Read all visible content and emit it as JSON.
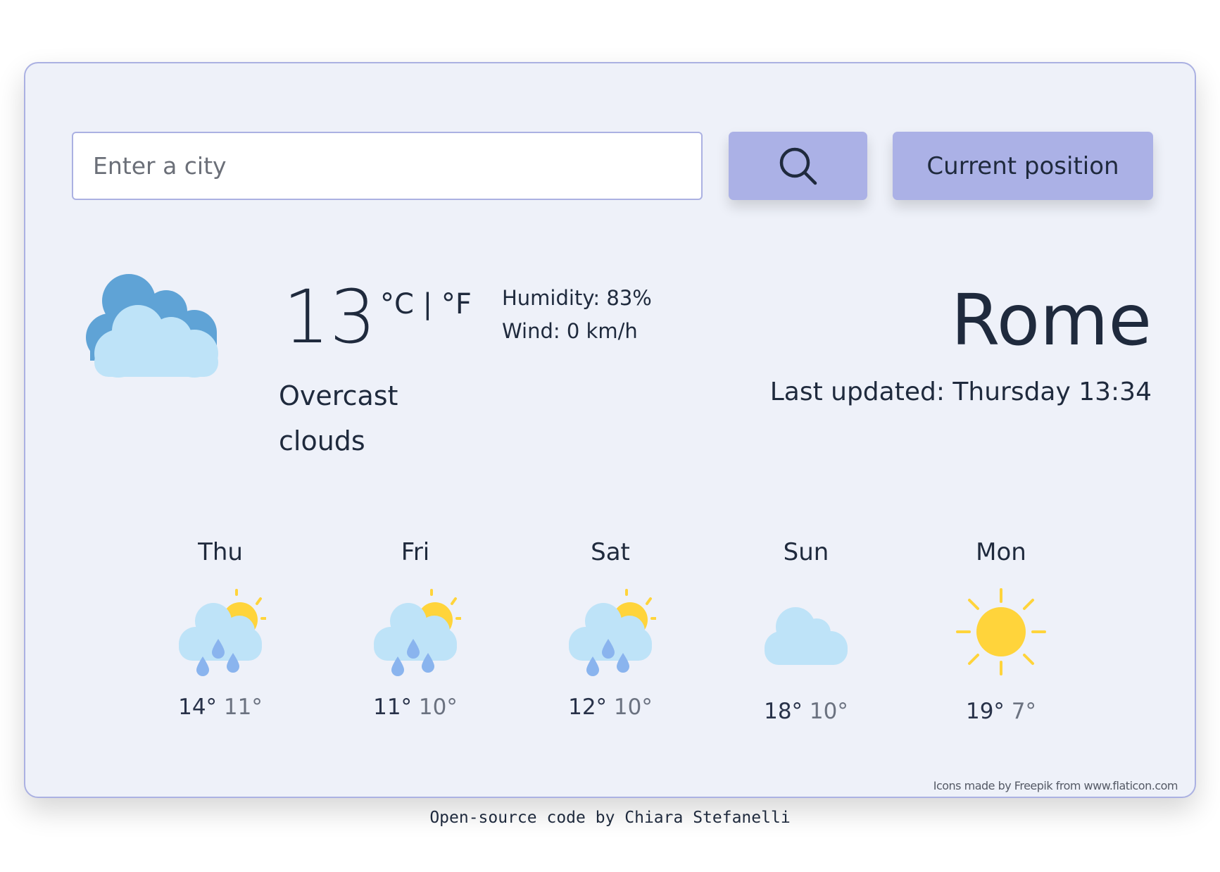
{
  "search": {
    "placeholder": "Enter a city",
    "value": "",
    "search_button_icon": "search-icon",
    "current_position_label": "Current position"
  },
  "current": {
    "icon": "overcast-clouds-icon",
    "temperature": "13",
    "unit_celsius": "°C",
    "unit_separator": "|",
    "unit_fahrenheit": "°F",
    "humidity": "Humidity: 83%",
    "wind": "Wind: 0 km/h",
    "description": "Overcast clouds",
    "city": "Rome",
    "last_updated": "Last updated: Thursday 13:34"
  },
  "forecast": [
    {
      "day": "Thu",
      "icon": "rain-sun-icon",
      "max": "14°",
      "min": "11°"
    },
    {
      "day": "Fri",
      "icon": "rain-sun-icon",
      "max": "11°",
      "min": "10°"
    },
    {
      "day": "Sat",
      "icon": "rain-sun-icon",
      "max": "12°",
      "min": "10°"
    },
    {
      "day": "Sun",
      "icon": "cloud-icon",
      "max": "18°",
      "min": "10°"
    },
    {
      "day": "Mon",
      "icon": "sun-icon",
      "max": "19°",
      "min": "7°"
    }
  ],
  "credits": {
    "prefix": "Icons made by ",
    "author": "Freepik",
    "middle": " from ",
    "site": "www.flaticon.com"
  },
  "footer": {
    "prefix": "Open-source code",
    "middle": " by ",
    "author": "Chiara Stefanelli"
  },
  "colors": {
    "card_background": "#eef1f9",
    "accent": "#abb1e6",
    "text": "#1f2a3d",
    "cloud_dark": "#5fa3d6",
    "cloud_light": "#bee3f8",
    "sun": "#ffd43b",
    "rain": "#8ab4ee"
  }
}
